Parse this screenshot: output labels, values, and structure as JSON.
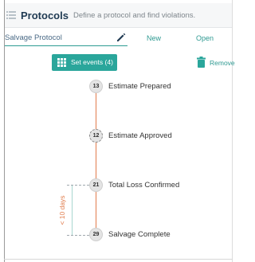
{
  "header": {
    "title": "Protocols",
    "subtitle": "Define a protocol and find violations."
  },
  "protocol": {
    "name": "Salvage Protocol",
    "new_label": "New",
    "open_label": "Open"
  },
  "toolbar": {
    "set_events_label": "Set events (4)",
    "remove_label": "Remove"
  },
  "events": [
    {
      "number": "13",
      "label": "Estimate Prepared"
    },
    {
      "number": "12",
      "label": "Estimate Approved"
    },
    {
      "number": "21",
      "label": "Total Loss Confirmed"
    },
    {
      "number": "29",
      "label": "Salvage Complete"
    }
  ],
  "constraint": {
    "label": "< 10 days"
  },
  "colors": {
    "accent": "#2aa69b",
    "link": "#2f9a92",
    "timeline": "#e27c4c",
    "constraint": "#e07b4a",
    "title": "#1f3a52"
  }
}
